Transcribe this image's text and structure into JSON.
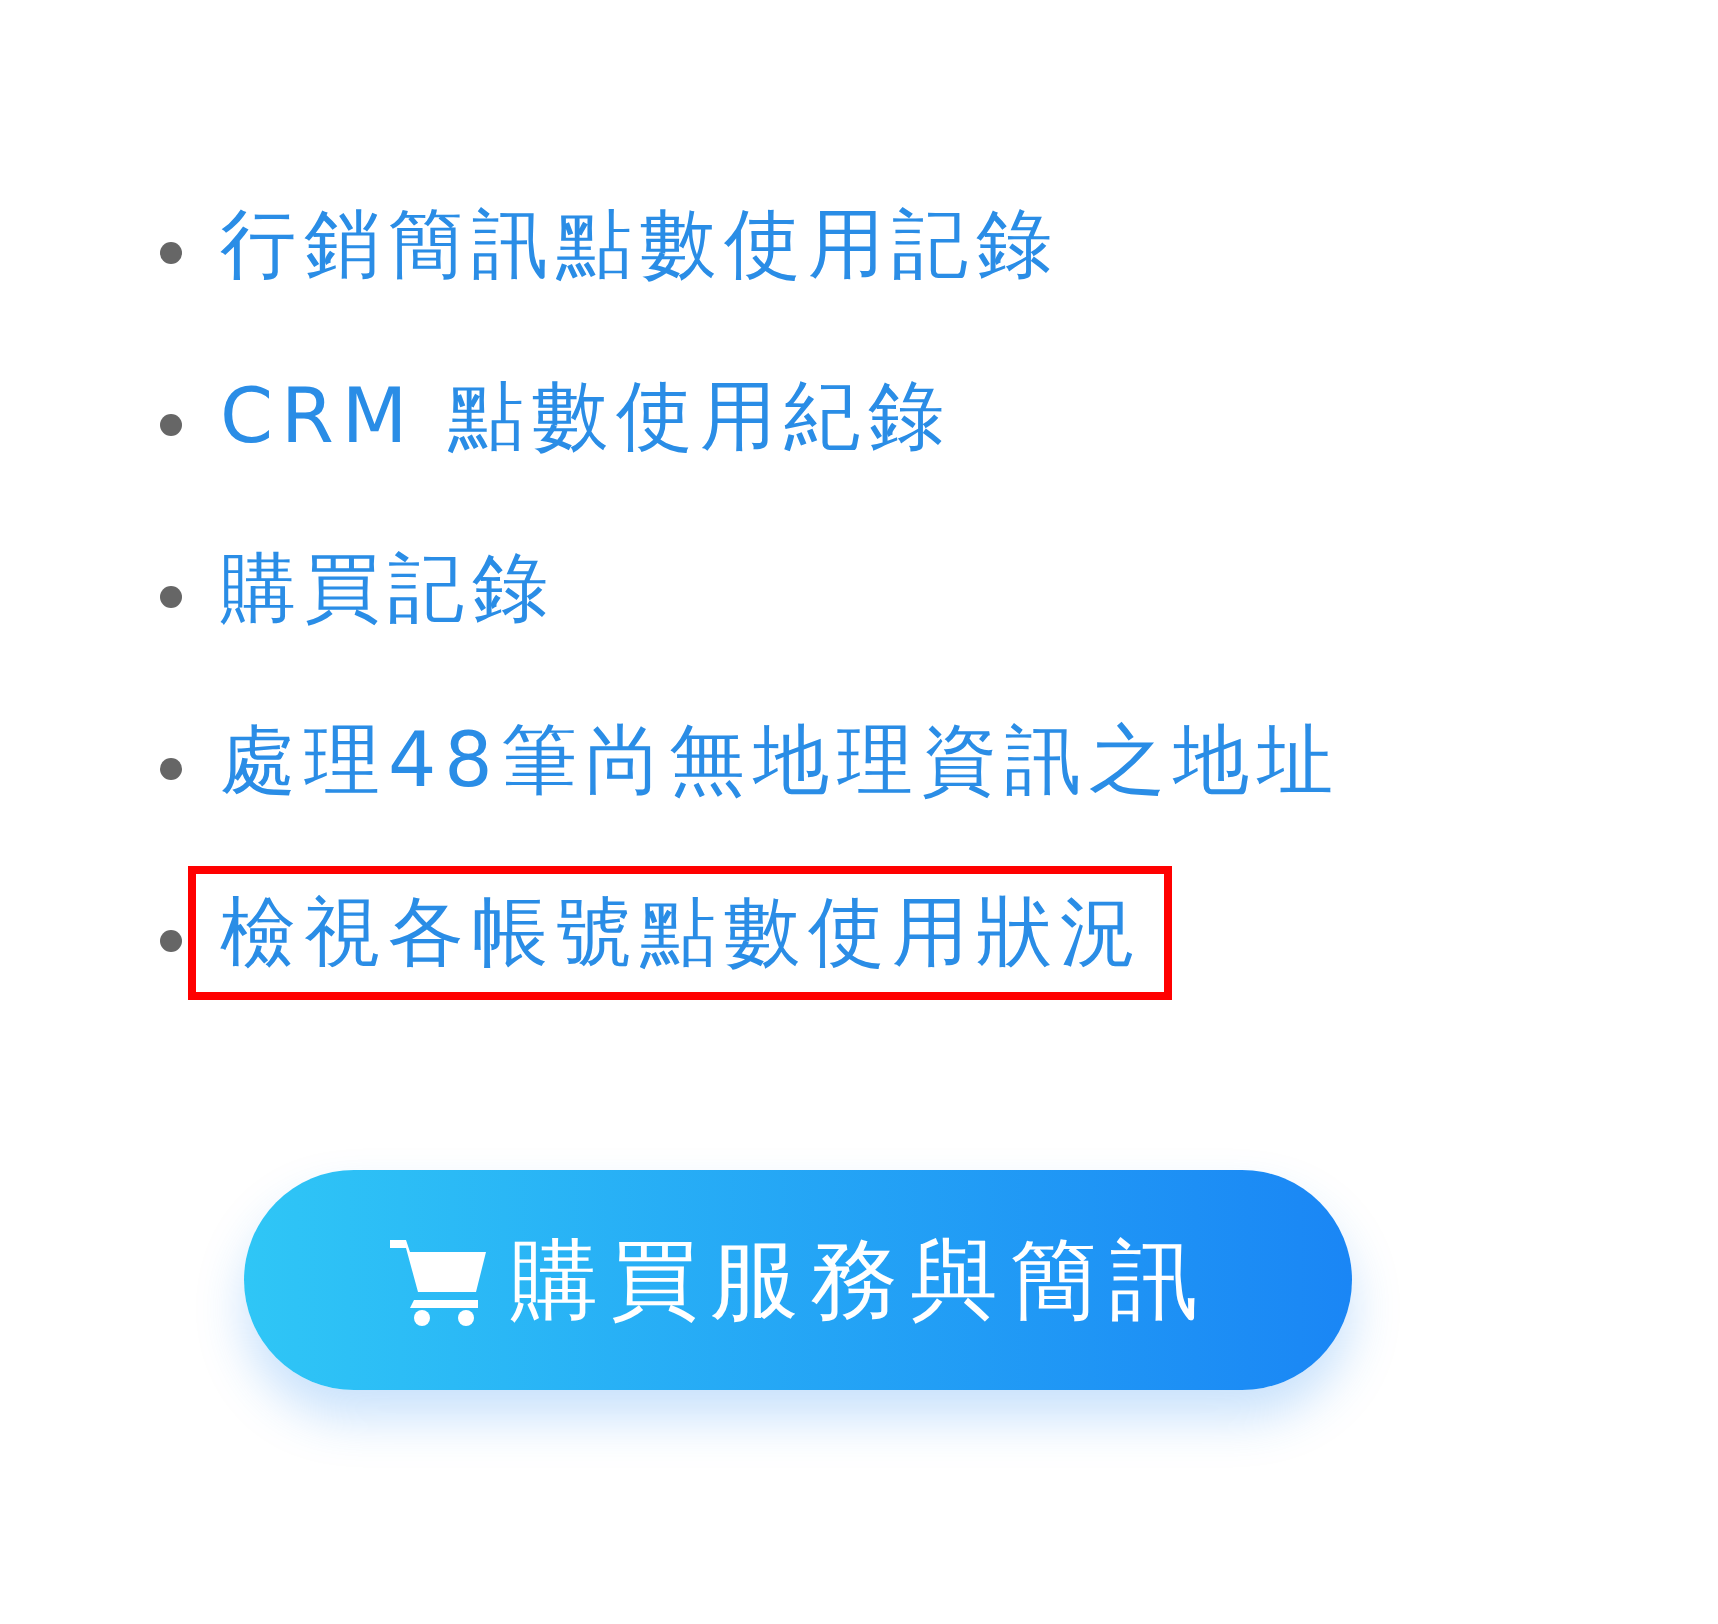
{
  "links": [
    {
      "label": "行銷簡訊點數使用記錄",
      "highlighted": false
    },
    {
      "label": "CRM 點數使用紀錄",
      "highlighted": false
    },
    {
      "label": "購買記錄",
      "highlighted": false
    },
    {
      "label": "處理48筆尚無地理資訊之地址",
      "highlighted": false
    },
    {
      "label": "檢視各帳號點數使用狀況",
      "highlighted": true
    }
  ],
  "button": {
    "label": "購買服務與簡訊"
  }
}
